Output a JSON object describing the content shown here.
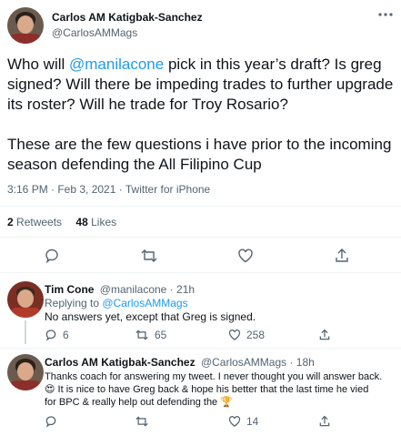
{
  "main_tweet": {
    "author_name": "Carlos AM Katigbak-Sanchez",
    "author_handle": "@CarlosAMMags",
    "text_part1": "Who will ",
    "mention": "@manilacone",
    "text_part2": " pick in this year’s draft? Is greg signed? Will there be impeding trades to further upgrade its roster? Will he trade for Troy Rosario?",
    "text_para2": "These are the few questions i have prior to the incoming season defending the All Filipino Cup",
    "meta_time": "3:16 PM · Feb 3, 2021 · ",
    "meta_source": "Twitter for iPhone",
    "retweets_count": "2",
    "retweets_label": "Retweets",
    "likes_count": "48",
    "likes_label": "Likes"
  },
  "reply1": {
    "author_name": "Tim Cone",
    "author_handle": "@manilacone · 21h",
    "replying_label": "Replying to ",
    "replying_to": "@CarlosAMMags",
    "text": "No answers yet, except that Greg is signed.",
    "reply_count": "6",
    "retweet_count": "65",
    "like_count": "258"
  },
  "reply2": {
    "author_name": "Carlos AM Katigbak-Sanchez",
    "author_handle": "@CarlosAMMags · 18h",
    "text_line1": "Thanks coach for answering my tweet. I never thought you will answer back.",
    "text_line2": "😍 It is nice to have Greg back & hope his better that the last time he vied",
    "text_line3": "for BPC & really help out defending the 🏆",
    "like_count": "14"
  },
  "icons": {
    "more": "more-horizontal-icon",
    "reply": "reply-bubble-icon",
    "retweet": "retweet-icon",
    "like": "heart-icon",
    "share": "share-icon"
  }
}
